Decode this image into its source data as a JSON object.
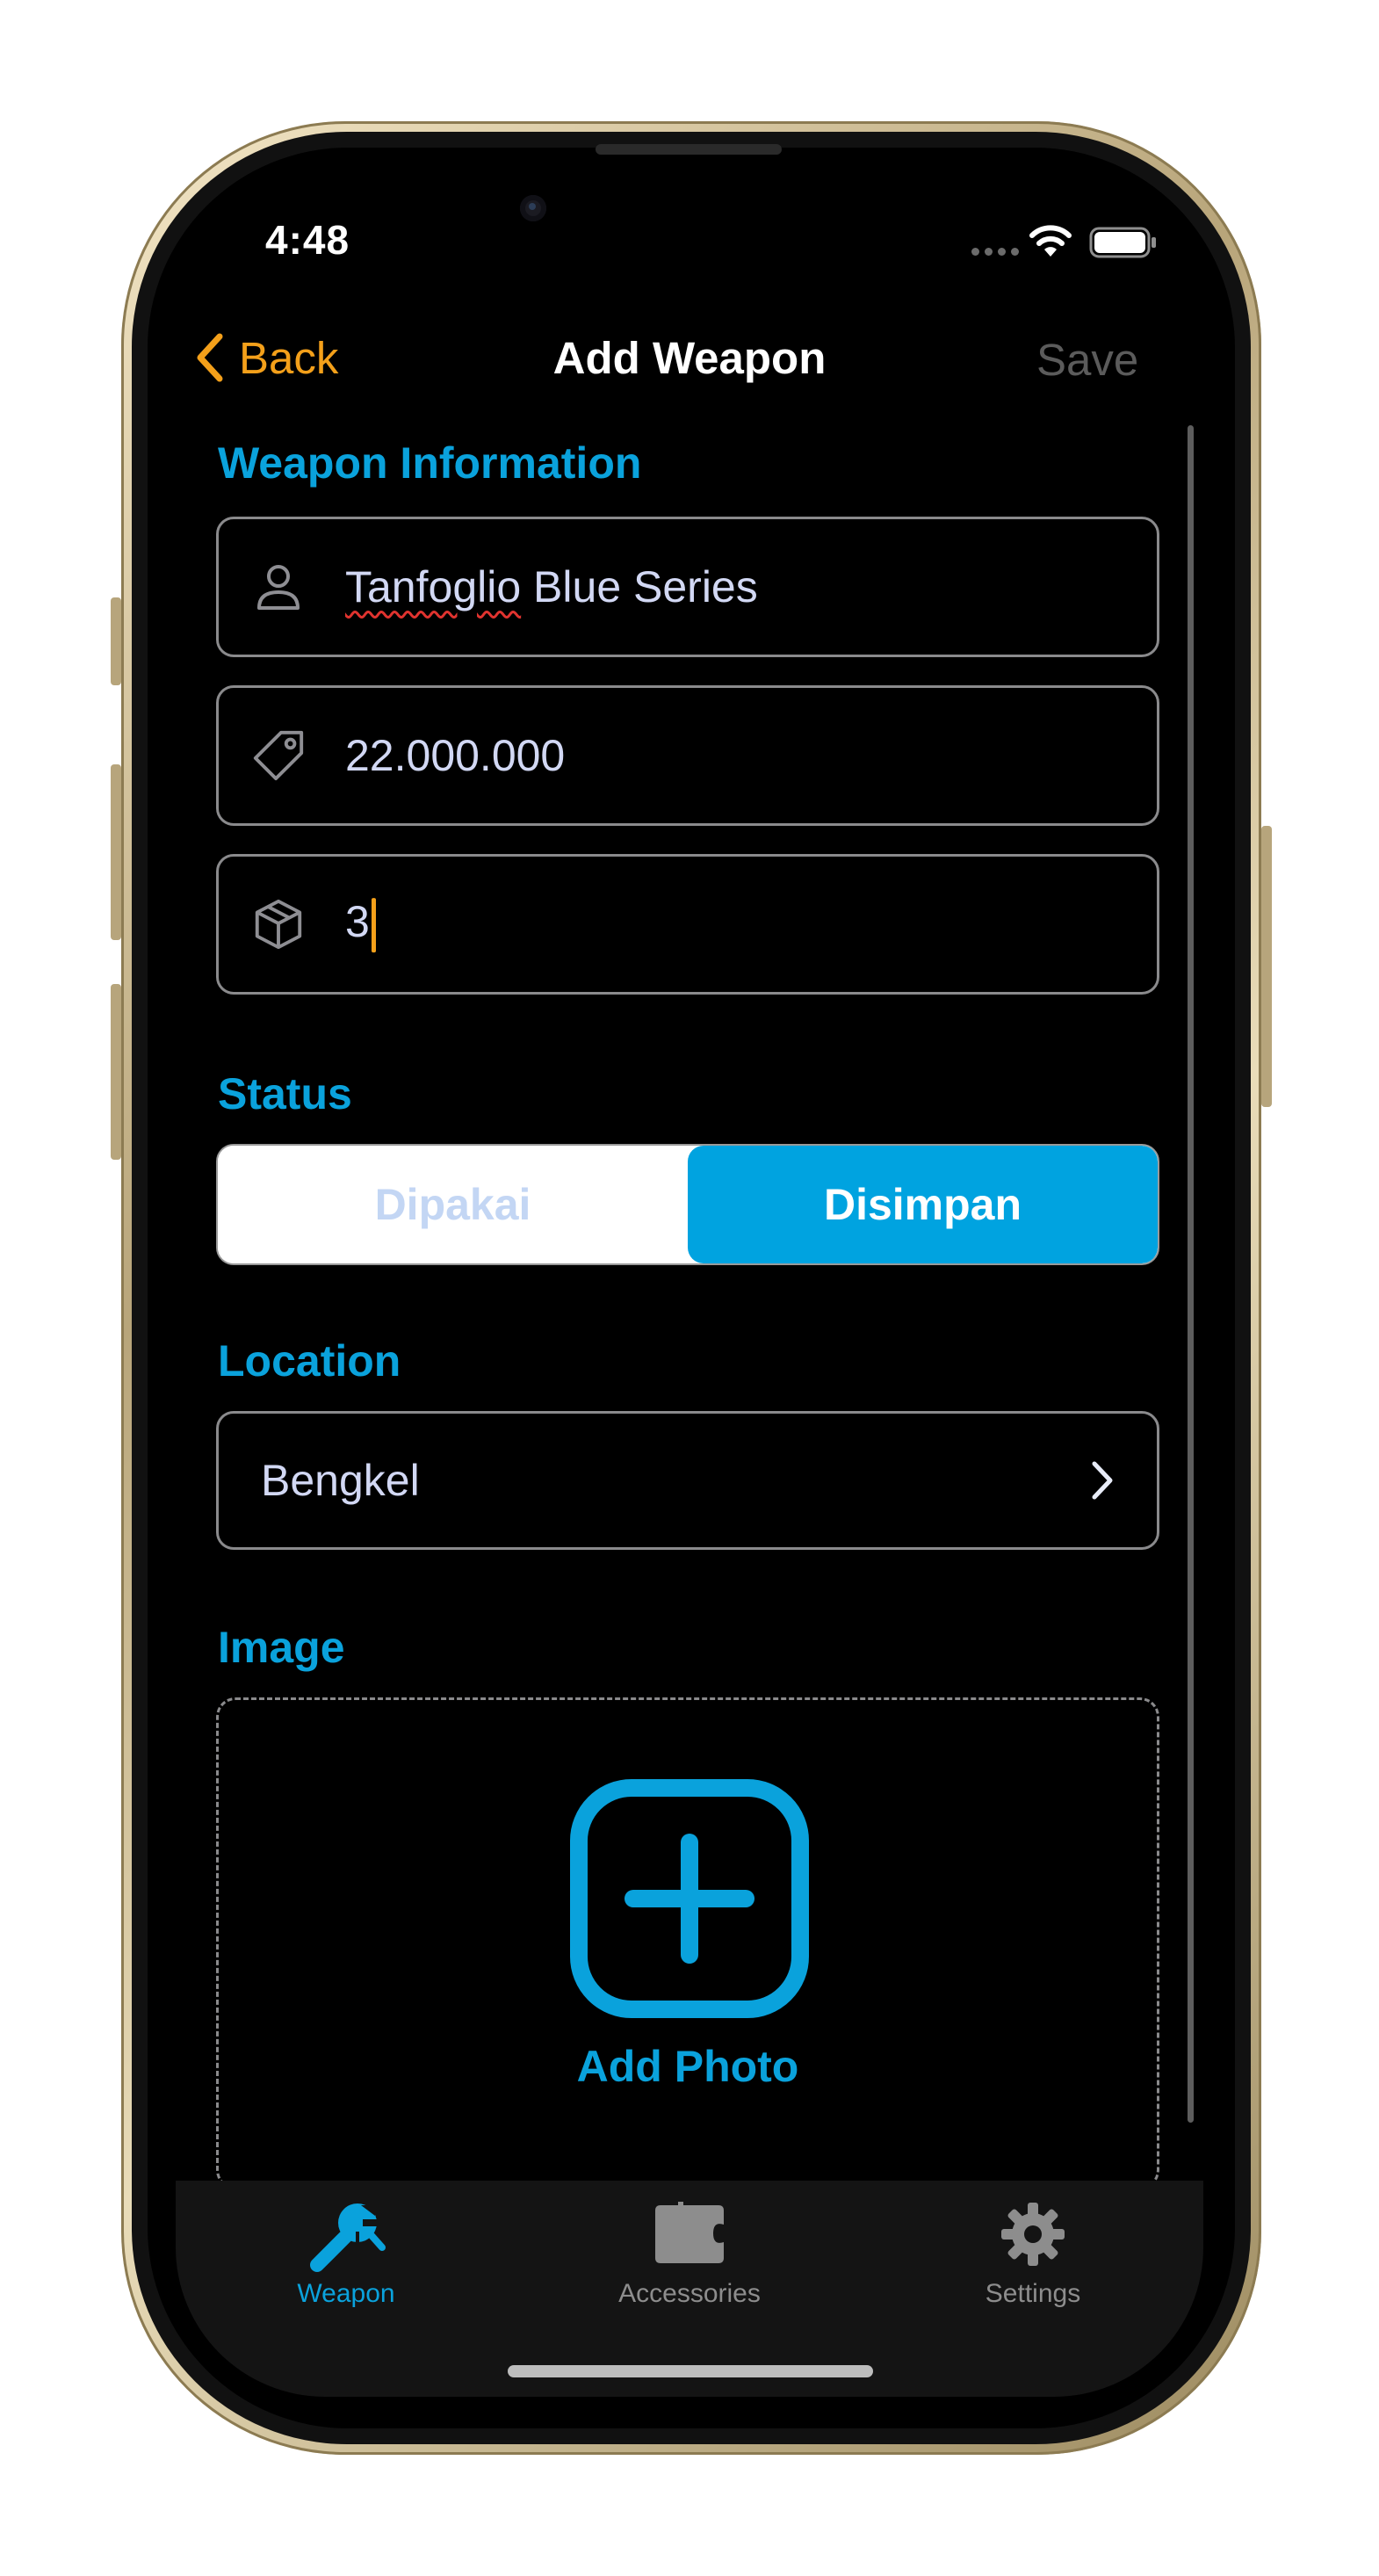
{
  "status_bar": {
    "time": "4:48"
  },
  "nav": {
    "back_label": "Back",
    "title": "Add Weapon",
    "save_label": "Save"
  },
  "weapon_information": {
    "section_label": "Weapon Information",
    "name_value": "Tanfoglio",
    "name_value_rest": " Blue Series",
    "price_value": "22.000.000",
    "quantity_value": "3"
  },
  "status": {
    "section_label": "Status",
    "options": [
      "Dipakai",
      "Disimpan"
    ],
    "selected": "Disimpan"
  },
  "location": {
    "section_label": "Location",
    "value": "Bengkel"
  },
  "image": {
    "section_label": "Image",
    "add_photo_label": "Add Photo"
  },
  "tab_bar": {
    "tabs": [
      {
        "label": "Weapon",
        "icon": "wrench-icon",
        "active": true
      },
      {
        "label": "Accessories",
        "icon": "puzzle-icon",
        "active": false
      },
      {
        "label": "Settings",
        "icon": "gear-icon",
        "active": false
      }
    ]
  },
  "colors": {
    "accent_blue": "#0AA2DC",
    "back_orange": "#F4A01A",
    "background": "#000000",
    "field_text": "#D2D8F4"
  }
}
